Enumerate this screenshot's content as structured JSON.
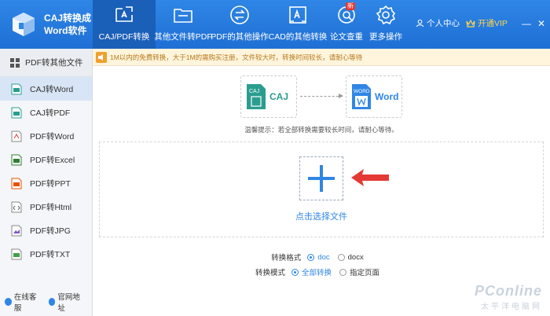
{
  "app": {
    "title_line1": "CAJ转换成",
    "title_line2": "Word软件"
  },
  "nav": [
    {
      "label": "CAJ/PDF转换",
      "icon": "convert-icon",
      "active": true
    },
    {
      "label": "其他文件转PDF",
      "icon": "folder-icon",
      "active": false
    },
    {
      "label": "PDF的其他操作",
      "icon": "pdf-ops-icon",
      "active": false
    },
    {
      "label": "CAD的其他转换",
      "icon": "cad-icon",
      "active": false
    },
    {
      "label": "论文查重",
      "icon": "search-paper-icon",
      "active": false,
      "badge": "新"
    },
    {
      "label": "更多操作",
      "icon": "gear-icon",
      "active": false
    }
  ],
  "account": {
    "user_label": "个人中心",
    "vip_label": "开通VIP",
    "min_symbol": "—",
    "close_symbol": "✕"
  },
  "sidebar": {
    "header": "PDF转其他文件",
    "items": [
      {
        "label": "CAJ转Word",
        "active": true
      },
      {
        "label": "CAJ转PDF",
        "active": false
      },
      {
        "label": "PDF转Word",
        "active": false
      },
      {
        "label": "PDF转Excel",
        "active": false
      },
      {
        "label": "PDF转PPT",
        "active": false
      },
      {
        "label": "PDF转Html",
        "active": false
      },
      {
        "label": "PDF转JPG",
        "active": false
      },
      {
        "label": "PDF转TXT",
        "active": false
      }
    ],
    "footer_service": "在线客服",
    "footer_site": "官网地址"
  },
  "main": {
    "notice": "1M以内的免费转换，大于1M的需购买注册，文件较大时，转换时间较长，请耐心等待",
    "flow_source_label": "CAJ",
    "flow_source_tag": "CAJ",
    "flow_target_label": "Word",
    "flow_target_tag": "WORD",
    "tip": "温馨提示：若全部转换需要较长时间，请耐心等待。",
    "upload_label": "点击选择文件",
    "format_label": "转换格式",
    "format_options": [
      {
        "label": "doc",
        "selected": true
      },
      {
        "label": "docx",
        "selected": false
      }
    ],
    "mode_label": "转换模式",
    "mode_options": [
      {
        "label": "全部转换",
        "selected": true
      },
      {
        "label": "指定页面",
        "selected": false
      }
    ]
  },
  "watermark": {
    "line1": "PConline",
    "line2": "太平洋电脑网"
  },
  "colors": {
    "brand_blue": "#2f86e6",
    "active_nav": "#1a5fb8",
    "arrow_red": "#e53935",
    "caj_teal": "#2a9d8f",
    "vip_gold": "#ffd54f"
  }
}
